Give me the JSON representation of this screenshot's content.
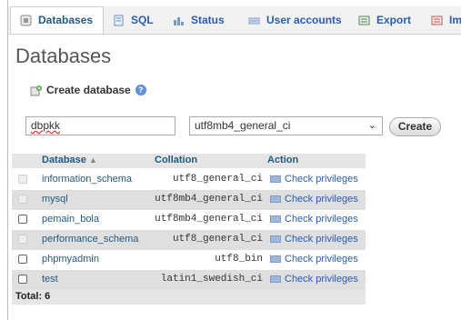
{
  "tabs": [
    {
      "label": "Databases",
      "icon": "database-icon",
      "active": true
    },
    {
      "label": "SQL",
      "icon": "sql-icon"
    },
    {
      "label": "Status",
      "icon": "status-icon"
    },
    {
      "label": "User accounts",
      "icon": "user-accounts-icon"
    },
    {
      "label": "Export",
      "icon": "export-icon"
    },
    {
      "label": "Im",
      "icon": "import-icon"
    }
  ],
  "page_title": "Databases",
  "create_section": {
    "label": "Create database",
    "help_icon": "help-icon",
    "db_name_value": "dbpkk",
    "collation_selected": "utf8mb4_general_ci",
    "create_button": "Create"
  },
  "table": {
    "headers": [
      "Database",
      "Collation",
      "Action"
    ],
    "rows": [
      {
        "name": "information_schema",
        "collation": "utf8_general_ci",
        "action": "Check privileges",
        "checkbox_enabled": false
      },
      {
        "name": "mysql",
        "collation": "utf8mb4_general_ci",
        "action": "Check privileges",
        "checkbox_enabled": false
      },
      {
        "name": "pemain_bola",
        "collation": "utf8mb4_general_ci",
        "action": "Check privileges",
        "checkbox_enabled": true
      },
      {
        "name": "performance_schema",
        "collation": "utf8_general_ci",
        "action": "Check privileges",
        "checkbox_enabled": false
      },
      {
        "name": "phpmyadmin",
        "collation": "utf8_bin",
        "action": "Check privileges",
        "checkbox_enabled": true
      },
      {
        "name": "test",
        "collation": "latin1_swedish_ci",
        "action": "Check privileges",
        "checkbox_enabled": true
      }
    ],
    "total_label": "Total: 6"
  },
  "colors": {
    "link": "#235a81",
    "header_bg": "#e5e5e5",
    "even_row_bg": "#dfdfdf"
  }
}
